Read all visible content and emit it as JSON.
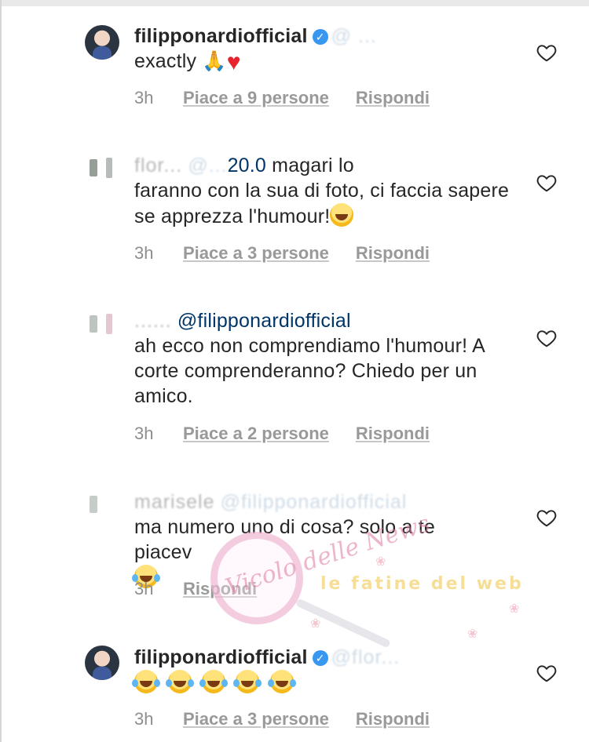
{
  "comments": [
    {
      "username": "filipponardiofficial",
      "verified": true,
      "mention_blurred": "@ ...",
      "text": "exactly",
      "time": "3h",
      "likes": "Piace a 9 persone",
      "reply": "Rispondi"
    },
    {
      "username_blurred": "flor...",
      "mention_blurred": "@...",
      "mention_tail": "20.0",
      "text_first": " magari lo",
      "text_rest": "faranno con la sua di foto, ci faccia sapere se apprezza l'humour!",
      "time": "3h",
      "likes": "Piace a 3 persone",
      "reply": "Rispondi"
    },
    {
      "username_blurred": "......",
      "mention": "@filipponardiofficial",
      "text": "ah ecco non comprendiamo l'humour! A corte comprenderanno? Chiedo per un amico.",
      "time": "3h",
      "likes": "Piace a 2 persone",
      "reply": "Rispondi"
    },
    {
      "username_blurred": "marisele",
      "mention_blurred": "@filipponardiofficial",
      "text": "ma numero uno di cosa? solo a te piacev",
      "time": "3h",
      "reply": "Rispondi"
    },
    {
      "username": "filipponardiofficial",
      "verified": true,
      "mention_blurred": "@flor...",
      "time": "3h",
      "likes": "Piace a 3 persone",
      "reply": "Rispondi"
    }
  ],
  "watermark": {
    "script_text": "Vicolo delle News",
    "banner_text": "le fatine del web"
  },
  "icons": {
    "like": "heart-outline-icon",
    "verified": "verified-badge-icon"
  },
  "colors": {
    "text": "#262626",
    "meta": "#8e8e8e",
    "mention": "#003569",
    "verified": "#3897f0"
  }
}
